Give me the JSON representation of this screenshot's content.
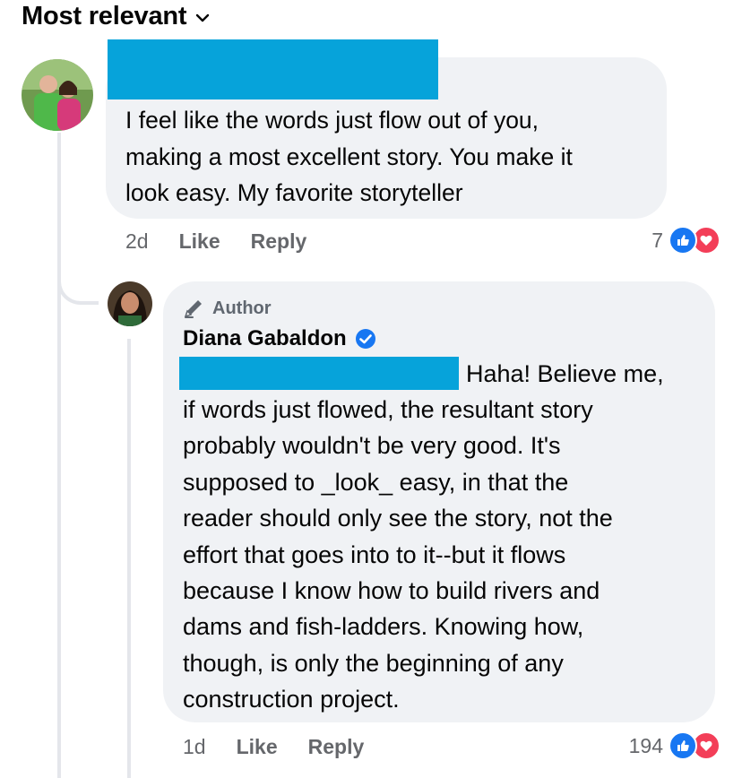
{
  "sort": {
    "label": "Most relevant"
  },
  "comments": [
    {
      "text_lines": [
        "I feel like the words just flow out of you,",
        "making a most excellent story. You make it",
        "look easy. My favorite storyteller"
      ],
      "time": "2d",
      "like_label": "Like",
      "reply_label": "Reply",
      "reaction_count": "7"
    }
  ],
  "reply": {
    "badge": "Author",
    "author": "Diana Gabaldon",
    "verified": true,
    "first_line": "Haha!  Believe me,",
    "text_lines": [
      "if words just flowed, the resultant story",
      "probably wouldn't be very good.  It's",
      "supposed to _look_ easy, in that the",
      "reader should only see the story, not the",
      "effort that goes into to it--but it flows",
      "because I know how to build rivers and",
      "dams and fish-ladders. Knowing how,",
      "though, is only the beginning of any",
      "construction project."
    ],
    "time": "1d",
    "like_label": "Like",
    "reply_label": "Reply",
    "reaction_count": "194"
  },
  "colors": {
    "bubble": "#f0f2f5",
    "redaction": "#06a3da",
    "like_blue": "#1877f2",
    "love_red": "#f33e58",
    "meta_gray": "#65676b"
  },
  "icons": [
    "chevron-down-icon",
    "pencil-icon",
    "verified-badge-icon",
    "like-reaction-icon",
    "love-reaction-icon"
  ]
}
